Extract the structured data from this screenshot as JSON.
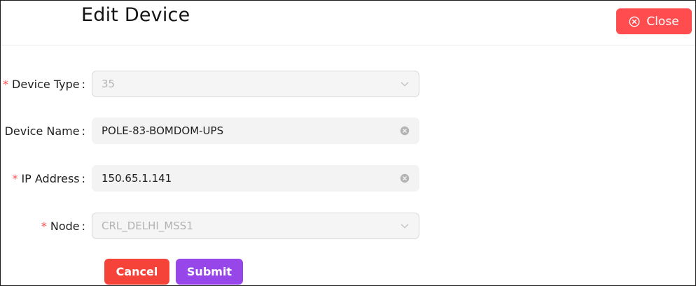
{
  "header": {
    "title": "Edit Device",
    "close_label": "Close"
  },
  "form": {
    "device_type": {
      "label": "Device Type",
      "value": "35",
      "required": true
    },
    "device_name": {
      "label": "Device Name",
      "value": "POLE-83-BOMDOM-UPS",
      "required": false
    },
    "ip_address": {
      "label": "IP Address",
      "value": "150.65.1.141",
      "required": true
    },
    "node": {
      "label": "Node",
      "value": "CRL_DELHI_MSS1",
      "required": true
    },
    "colon": ":",
    "required_mark": "*"
  },
  "actions": {
    "cancel_label": "Cancel",
    "submit_label": "Submit"
  },
  "colors": {
    "danger": "#ff4d4f",
    "primary": "#9747e9"
  }
}
